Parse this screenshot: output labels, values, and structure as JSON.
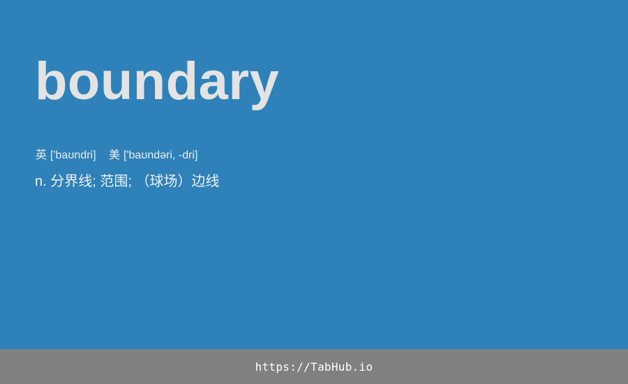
{
  "entry": {
    "word": "boundary",
    "phonetics": {
      "uk_label": "英",
      "uk_ipa": "['baʊndri]",
      "us_label": "美",
      "us_ipa": "['baʊndəri, -dri]"
    },
    "definition": "n. 分界线; 范围; （球场）边线"
  },
  "footer": {
    "link_text": "https://TabHub.io"
  },
  "colors": {
    "background": "#2f81b9",
    "word_text": "#e3e3e3",
    "footer_background": "#808080",
    "footer_text": "#ffffff"
  }
}
